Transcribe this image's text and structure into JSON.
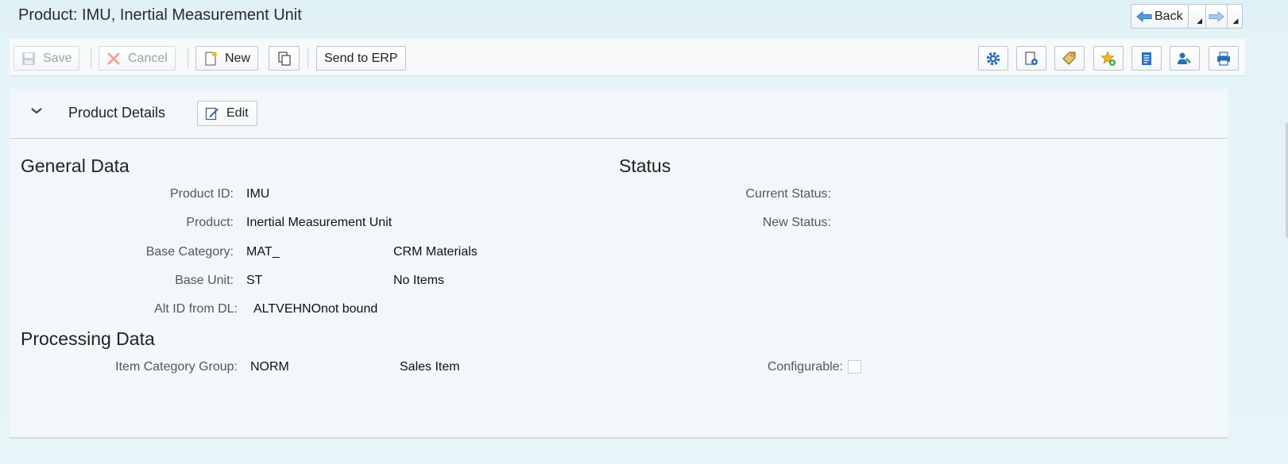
{
  "page": {
    "title": "Product: IMU, Inertial Measurement Unit"
  },
  "navigation": {
    "back_label": "Back",
    "icons": [
      "arrow-left-icon",
      "arrow-right-icon",
      "dropdown-icon"
    ]
  },
  "toolbar": {
    "save_label": "Save",
    "cancel_label": "Cancel",
    "new_label": "New",
    "send_label": "Send to ERP",
    "icons": [
      "settings-icon",
      "personalize-icon",
      "tag-icon",
      "favorite-icon",
      "document-icon",
      "user-settings-icon",
      "print-icon"
    ]
  },
  "panel": {
    "title": "Product Details",
    "edit_label": "Edit"
  },
  "general_data": {
    "title": "General Data",
    "product_id_label": "Product ID:",
    "product_id_value": "IMU",
    "product_label": "Product:",
    "product_value": "Inertial Measurement Unit",
    "base_category_label": "Base Category:",
    "base_category_value": "MAT_",
    "base_category_desc": "CRM Materials",
    "base_unit_label": "Base Unit:",
    "base_unit_value": "ST",
    "base_unit_desc": "No Items",
    "alt_id_label": "Alt ID from DL:",
    "alt_id_value": "ALTVEHNOnot bound"
  },
  "status": {
    "title": "Status",
    "current_label": "Current Status:",
    "current_value": "",
    "new_label": "New Status:",
    "new_value": ""
  },
  "processing_data": {
    "title": "Processing Data",
    "item_cat_label": "Item Category Group:",
    "item_cat_value": "NORM",
    "item_cat_desc": "Sales Item",
    "configurable_label": "Configurable:",
    "configurable_checked": false
  },
  "colors": {
    "background": "#e4f3f8",
    "panel": "#f2f8fa",
    "toolbar": "#f7f9fa",
    "icon_blue": "#2a6ebb",
    "icon_gold": "#d8a21c"
  }
}
